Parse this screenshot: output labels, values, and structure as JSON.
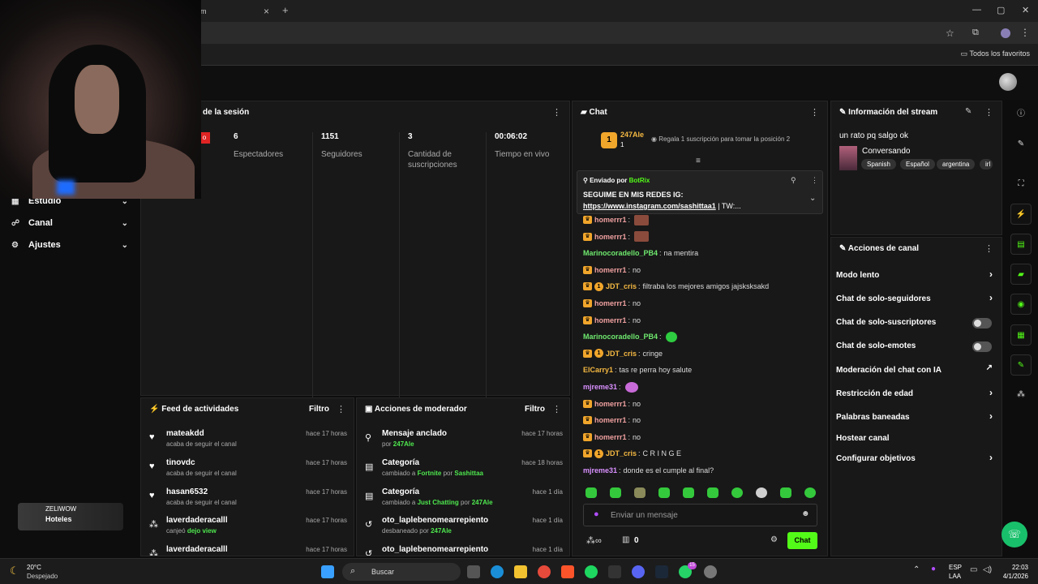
{
  "browser": {
    "tab_title": "m",
    "tab_close": "×",
    "new_tab": "+",
    "bookmarks_folder": "Todos los favoritos",
    "window_controls": [
      "—",
      "▢",
      "✕"
    ]
  },
  "sidebar": {
    "items": [
      {
        "label": "Estudio"
      },
      {
        "label": "Canal"
      },
      {
        "label": "Ajustes"
      }
    ],
    "promo": {
      "brand": "ZELIWOW",
      "label": "Hoteles"
    }
  },
  "session": {
    "title": "de la sesión",
    "live_badge": "o",
    "stats": [
      {
        "value": "6",
        "label": "Espectadores"
      },
      {
        "value": "1151",
        "label": "Seguidores"
      },
      {
        "value": "3",
        "label": "Cantidad de suscripciones"
      },
      {
        "value": "00:06:02",
        "label": "Tiempo en vivo"
      }
    ]
  },
  "activity_feed": {
    "title": "Feed de actividades",
    "filter": "Filtro",
    "rows": [
      {
        "name": "mateakdd",
        "sub": "acaba de seguir el canal",
        "time": "hace 17 horas",
        "icon": "heart-icon"
      },
      {
        "name": "tinovdc",
        "sub": "acaba de seguir el canal",
        "time": "hace 17 horas",
        "icon": "heart-icon"
      },
      {
        "name": "hasan6532",
        "sub": "acaba de seguir el canal",
        "time": "hace 17 horas",
        "icon": "heart-icon"
      },
      {
        "name": "laverdaderacalll",
        "sub_prefix": "canjeó",
        "sub_highlight": "dejo view",
        "time": "hace 17 horas",
        "icon": "reward-icon"
      },
      {
        "name": "laverdaderacalll",
        "sub": "",
        "time": "hace 17 horas",
        "icon": "reward-icon"
      }
    ]
  },
  "mod_actions": {
    "title": "Acciones de moderador",
    "filter": "Filtro",
    "rows": [
      {
        "name": "Mensaje anclado",
        "prefix": "por",
        "h1": "247Ale",
        "mid": "",
        "h2": "",
        "time": "hace 17 horas"
      },
      {
        "name": "Categoría",
        "prefix": "cambiado a",
        "h1": "Fortnite",
        "mid": "por",
        "h2": "Sashittaa",
        "time": "hace 18 horas"
      },
      {
        "name": "Categoría",
        "prefix": "cambiado a",
        "h1": "Just Chatting",
        "mid": "por",
        "h2": "247Ale",
        "time": "hace 1 día"
      },
      {
        "name": "oto_laplebenomearrepiento",
        "prefix": "desbaneado por",
        "h1": "247Ale",
        "mid": "",
        "h2": "",
        "time": "hace 1 día"
      },
      {
        "name": "oto_laplebenomearrepiento",
        "prefix": "",
        "h1": "",
        "mid": "",
        "h2": "",
        "time": "hace 1 día"
      }
    ]
  },
  "chat": {
    "title": "Chat",
    "gifter": {
      "name": "247Ale",
      "count": "1",
      "rank": "1",
      "promo": "Regala 1 suscripción para tomar la posición 2"
    },
    "pinned": {
      "sent_by": "Enviado por",
      "bot": "BotRix",
      "line1": "SEGUIME EN MIS REDES",
      "line1b": "IG:",
      "link": "https://www.instagram.com/sashittaa1",
      "tail": "| TW:..."
    },
    "messages": [
      {
        "user": "homerrr1",
        "text": "",
        "color": "#f0a0a0",
        "crown": true,
        "one": false,
        "emote": "e"
      },
      {
        "user": "homerrr1",
        "text": "",
        "color": "#f0a0a0",
        "crown": true,
        "one": false,
        "emote": "e"
      },
      {
        "user": "Marinocoradello_PB4",
        "text": "na mentira",
        "color": "#6ee86e",
        "crown": false,
        "one": false,
        "emote": ""
      },
      {
        "user": "homerrr1",
        "text": "no",
        "color": "#f0a0a0",
        "crown": true,
        "one": false,
        "emote": ""
      },
      {
        "user": "JDT_cris",
        "text": "filtraba los mejores amigos jajsksksakd",
        "color": "#f5b942",
        "crown": true,
        "one": true,
        "emote": ""
      },
      {
        "user": "homerrr1",
        "text": "no",
        "color": "#f0a0a0",
        "crown": true,
        "one": false,
        "emote": ""
      },
      {
        "user": "homerrr1",
        "text": "no",
        "color": "#f0a0a0",
        "crown": true,
        "one": false,
        "emote": ""
      },
      {
        "user": "Marinocoradello_PB4",
        "text": "",
        "color": "#6ee86e",
        "crown": false,
        "one": false,
        "emote": "g"
      },
      {
        "user": "JDT_cris",
        "text": "cringe",
        "color": "#f5b942",
        "crown": true,
        "one": true,
        "emote": ""
      },
      {
        "user": "ElCarry1",
        "text": "tas re perra hoy salute",
        "color": "#f5b942",
        "crown": false,
        "one": false,
        "emote": ""
      },
      {
        "user": "mjreme31",
        "text": "",
        "color": "#d990ff",
        "crown": false,
        "one": false,
        "emote": "p"
      },
      {
        "user": "homerrr1",
        "text": "no",
        "color": "#f0a0a0",
        "crown": true,
        "one": false,
        "emote": ""
      },
      {
        "user": "homerrr1",
        "text": "no",
        "color": "#f0a0a0",
        "crown": true,
        "one": false,
        "emote": ""
      },
      {
        "user": "homerrr1",
        "text": "no",
        "color": "#f0a0a0",
        "crown": true,
        "one": false,
        "emote": ""
      },
      {
        "user": "JDT_cris",
        "text": "C R I N G E",
        "color": "#f5b942",
        "crown": true,
        "one": true,
        "emote": ""
      },
      {
        "user": "mjreme31",
        "text": "donde es el cumple al final?",
        "color": "#d990ff",
        "crown": false,
        "one": false,
        "emote": ""
      }
    ],
    "input_placeholder": "Enviar un mensaje",
    "send_label": "Chat",
    "viewers_count": "0"
  },
  "stream_info": {
    "title": "Información del stream",
    "stream_title": "un rato pq salgo ok",
    "category": "Conversando",
    "tags": [
      "Spanish",
      "Español",
      "argentina",
      "irl"
    ]
  },
  "channel_actions": {
    "title": "Acciones de canal",
    "items": [
      {
        "label": "Modo lento",
        "control": "chevron"
      },
      {
        "label": "Chat de solo-seguidores",
        "control": "chevron"
      },
      {
        "label": "Chat de solo-suscriptores",
        "control": "toggle"
      },
      {
        "label": "Chat de solo-emotes",
        "control": "toggle"
      },
      {
        "label": "Moderación del chat con IA",
        "control": "external"
      },
      {
        "label": "Restricción de edad",
        "control": "chevron"
      },
      {
        "label": "Palabras baneadas",
        "control": "chevron"
      },
      {
        "label": "Hostear canal",
        "control": "none"
      },
      {
        "label": "Configurar objetivos",
        "control": "chevron"
      }
    ]
  },
  "taskbar": {
    "weather_temp": "20°C",
    "weather_desc": "Despejado",
    "search_label": "Buscar",
    "lang": "ESP",
    "region": "LAA",
    "time": "22:03",
    "date": "4/1/2026",
    "notif_badge": "15"
  },
  "colors": {
    "accent": "#53fc18",
    "panel": "#181818"
  }
}
